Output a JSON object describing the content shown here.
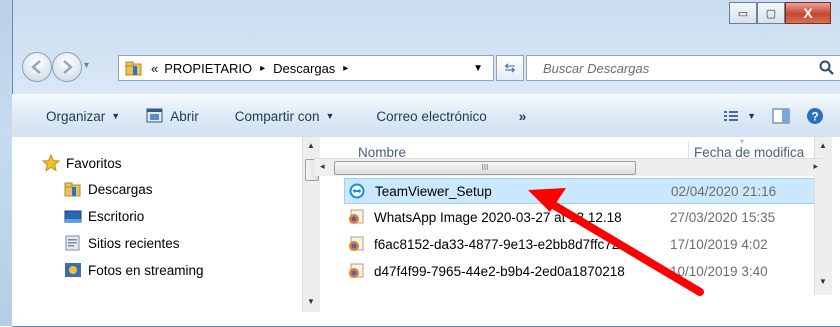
{
  "window": {
    "caption_minimize": "▭",
    "caption_maximize": "▢",
    "caption_close": "X"
  },
  "address": {
    "chevrons": "«",
    "segments": [
      "PROPIETARIO",
      "Descargas"
    ],
    "separator": "▸"
  },
  "search": {
    "placeholder": "Buscar Descargas"
  },
  "toolbar": {
    "organizar": "Organizar",
    "abrir": "Abrir",
    "compartir": "Compartir con",
    "correo": "Correo electrónico",
    "more": "»"
  },
  "nav": {
    "favoritos": "Favoritos",
    "items": [
      {
        "label": "Descargas",
        "icon": "folder-download-icon"
      },
      {
        "label": "Escritorio",
        "icon": "desktop-icon"
      },
      {
        "label": "Sitios recientes",
        "icon": "recent-places-icon"
      },
      {
        "label": "Fotos en streaming",
        "icon": "photo-stream-icon"
      }
    ]
  },
  "columns": {
    "name": "Nombre",
    "date": "Fecha de modifica"
  },
  "files": [
    {
      "name": "TeamViewer_Setup",
      "date": "02/04/2020 21:16",
      "icon": "teamviewer-icon",
      "selected": true
    },
    {
      "name": "WhatsApp Image 2020-03-27 at 13.12.18",
      "date": "27/03/2020 15:35",
      "icon": "image-file-icon"
    },
    {
      "name": "f6ac8152-da33-4877-9e13-e2bb8d7ffc72",
      "date": "17/10/2019 4:02",
      "icon": "image-file-icon"
    },
    {
      "name": "d47f4f99-7965-44e2-b9b4-2ed0a1870218",
      "date": "10/10/2019 3:40",
      "icon": "image-file-icon"
    }
  ],
  "hscroll_grip": "III",
  "colors": {
    "selection": "#cce8ff",
    "arrow": "#ff0000",
    "teamviewer": "#0e8ee9"
  }
}
